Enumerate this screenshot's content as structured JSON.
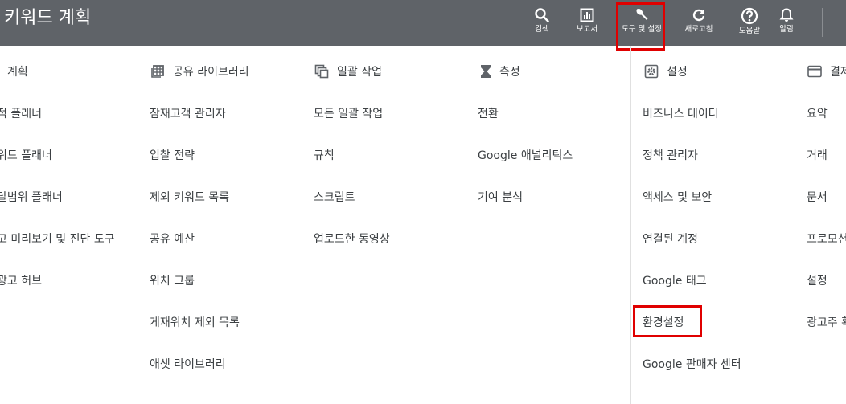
{
  "header": {
    "title": "키워드 계획",
    "buttons": [
      {
        "label": "검색",
        "icon": "search-icon"
      },
      {
        "label": "보고서",
        "icon": "reports-icon"
      },
      {
        "label": "도구 및 설정",
        "icon": "wrench-icon"
      },
      {
        "label": "새로고침",
        "icon": "refresh-icon"
      },
      {
        "label": "도움말",
        "icon": "help-icon"
      },
      {
        "label": "알림",
        "icon": "bell-icon"
      }
    ]
  },
  "columns": [
    {
      "heading": "계획",
      "items": [
        "적 플래너",
        "워드 플래너",
        "달범위 플래너",
        "고 미리보기 및 진단 도구",
        "광고 허브"
      ]
    },
    {
      "heading": "공유 라이브러리",
      "icon": "library-icon",
      "items": [
        "잠재고객 관리자",
        "입찰 전략",
        "제외 키워드 목록",
        "공유 예산",
        "위치 그룹",
        "게재위치 제외 목록",
        "애셋 라이브러리"
      ]
    },
    {
      "heading": "일괄 작업",
      "icon": "bulk-actions-icon",
      "items": [
        "모든 일괄 작업",
        "규칙",
        "스크립트",
        "업로드한 동영상"
      ]
    },
    {
      "heading": "측정",
      "icon": "hourglass-icon",
      "items": [
        "전환",
        "Google 애널리틱스",
        "기여 분석"
      ]
    },
    {
      "heading": "설정",
      "icon": "settings-icon",
      "items": [
        "비즈니스 데이터",
        "정책 관리자",
        "액세스 및 보안",
        "연결된 계정",
        "Google 태그",
        "환경설정",
        "Google 판매자 센터"
      ]
    },
    {
      "heading": "결제",
      "icon": "billing-icon",
      "items": [
        "요약",
        "거래",
        "문서",
        "프로모션",
        "설정",
        "광고주 확인"
      ]
    }
  ],
  "colors": {
    "topbar": "#5f6368",
    "highlight": "#e00000",
    "divider": "#e0e0e0"
  }
}
